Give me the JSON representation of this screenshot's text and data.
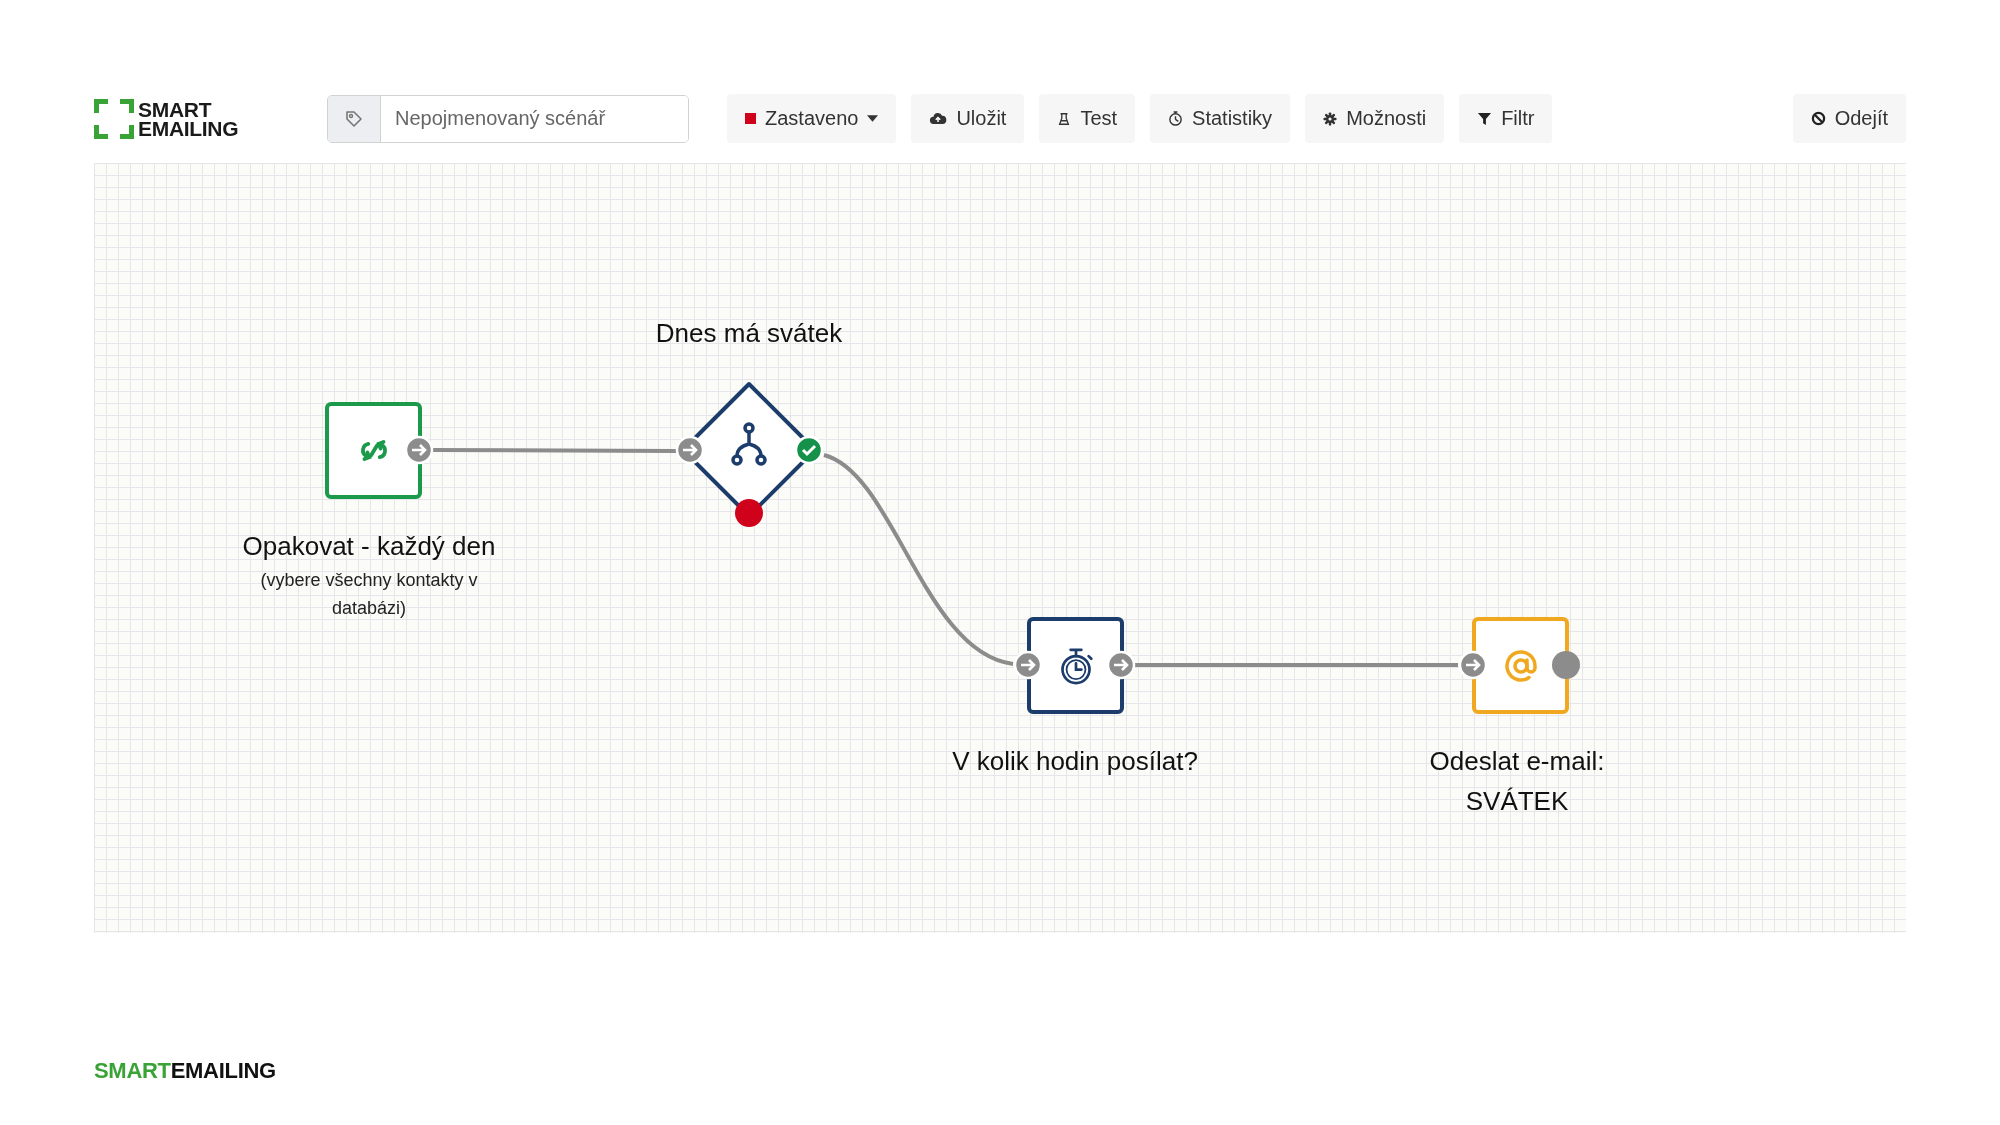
{
  "logo": {
    "top": "SMART",
    "bottom": "EMAILING"
  },
  "scenario_field": {
    "placeholder": "Nepojmenovaný scénář"
  },
  "toolbar": [
    {
      "kind": "status",
      "label": "Zastaveno",
      "color": "#d0021b"
    },
    {
      "kind": "save",
      "label": "Uložit"
    },
    {
      "kind": "test",
      "label": "Test"
    },
    {
      "kind": "stats",
      "label": "Statistiky"
    },
    {
      "kind": "options",
      "label": "Možnosti"
    },
    {
      "kind": "filter",
      "label": "Filtr"
    }
  ],
  "exit_button": {
    "label": "Odejít"
  },
  "nodes": [
    {
      "kind": "trigger",
      "color": "#1a9a4a",
      "title": [
        "Opakovat - každý den"
      ],
      "subtitle": "(vybere všechny kontakty v databázi)"
    },
    {
      "kind": "condition",
      "color": "#1c3c6b",
      "title": [
        "Dnes má svátek"
      ]
    },
    {
      "kind": "delay",
      "color": "#1c3c6b",
      "title": [
        "V kolik hodin posílat?"
      ]
    },
    {
      "kind": "email",
      "color": "#f0a820",
      "title": [
        "Odeslat e-mail:",
        "SVÁTEK"
      ]
    }
  ],
  "footer": {
    "brand_green": "SMART",
    "brand_dark": "EMAILING"
  }
}
